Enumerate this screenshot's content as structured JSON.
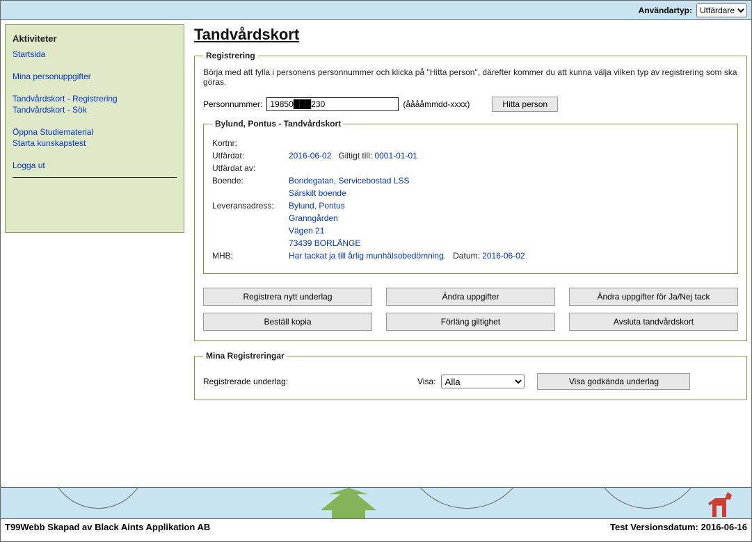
{
  "topbar": {
    "user_type_label": "Användartyp:",
    "user_type_value": "Utfärdare"
  },
  "sidebar": {
    "title": "Aktiviteter",
    "items": [
      "Startsida",
      "Mina personuppgifter",
      "Tandvårdskort - Registrering",
      "Tandvårdskort - Sök",
      "Öppna Studiematerial",
      "Starta kunskapstest",
      "Logga ut"
    ]
  },
  "page": {
    "title": "Tandvårdskort"
  },
  "registration": {
    "legend": "Registrering",
    "instruction": "Börja med att fylla i personens personnummer och klicka på \"Hitta person\", därefter kommer du att kunna välja vilken typ av registrering som ska göras.",
    "personnummer_label": "Personnummer:",
    "personnummer_value": "19850███230",
    "personnummer_hint": "(ååååmmdd-xxxx)",
    "hitta_button": "Hitta person"
  },
  "card": {
    "legend": "Bylund, Pontus - Tandvårdskort",
    "kortnr_label": "Kortnr:",
    "kortnr_value": "",
    "utfardat_label": "Utfärdat:",
    "utfardat_value": "2016-06-02",
    "giltigt_label": "Giltigt till:",
    "giltigt_value": "0001-01-01",
    "utfardat_av_label": "Utfärdat av:",
    "utfardat_av_value": "",
    "boende_label": "Boende:",
    "boende_value1": "Bondegatan, Servicebostad LSS",
    "boende_value2": "Särskilt boende",
    "leverans_label": "Leveransadress:",
    "leverans_line1": "Bylund, Pontus",
    "leverans_line2": "Granngården",
    "leverans_line3": "Vägen 21",
    "leverans_line4": "73439 BORLÄNGE",
    "mhb_label": "MHB:",
    "mhb_text": "Har tackat ja till årlig munhälsobedömning.",
    "mhb_datum_label": "Datum:",
    "mhb_datum_value": "2016-06-02"
  },
  "buttons": {
    "b1": "Registrera nytt underlag",
    "b2": "Ändra uppgifter",
    "b3": "Ändra uppgifter för Ja/Nej tack",
    "b4": "Beställ kopia",
    "b5": "Förläng giltighet",
    "b6": "Avsluta tandvårdskort"
  },
  "mina": {
    "legend": "Mina Registreringar",
    "list_label": "Registrerade underlag:",
    "visa_label": "Visa:",
    "visa_value": "Alla",
    "visa_button": "Visa godkända underlag"
  },
  "footer": {
    "left": "T99Webb Skapad av Black Aints Applikation AB",
    "right": "Test Versionsdatum: 2016-06-16"
  }
}
